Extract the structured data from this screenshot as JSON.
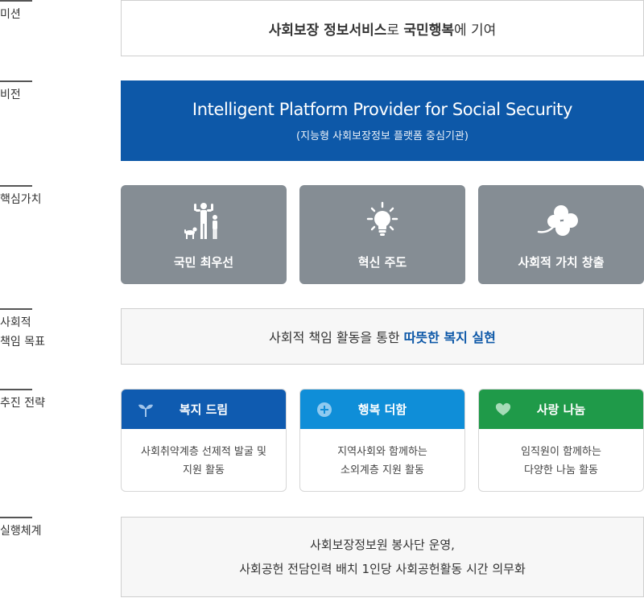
{
  "sections": {
    "mission": "미션",
    "vision": "비전",
    "core_values": "핵심가치",
    "csr_goal": "사회적\n책임 목표",
    "strategy": "추진 전략",
    "execution": "실행체계"
  },
  "mission": {
    "part1": "사회보장 정보서비스",
    "part2": "로 ",
    "part3": "국민행복",
    "part4": "에 기여"
  },
  "vision": {
    "english": "Intelligent Platform Provider for Social Security",
    "korean": "(지능형 사회보장정보 플랫폼 중심기관)",
    "color": "#0d58a8"
  },
  "core_values": [
    {
      "label": "국민 최우선",
      "icon": "family-icon"
    },
    {
      "label": "혁신 주도",
      "icon": "lightbulb-icon"
    },
    {
      "label": "사회적 가치 창출",
      "icon": "clover-icon"
    }
  ],
  "csr_goal": {
    "normal": "사회적 책임 활동을 통한 ",
    "highlight": "따뜻한 복지 실현"
  },
  "strategies": [
    {
      "title": "복지 드림",
      "desc": "사회취약계층 선제적 발굴 및\n지원 활동",
      "color": "#0f5bb0",
      "icon": "sprout-icon"
    },
    {
      "title": "행복 더함",
      "desc": "지역사회와 함께하는\n소외계층 지원 활동",
      "color": "#0f8ed8",
      "icon": "plus-circle-icon"
    },
    {
      "title": "사랑 나눔",
      "desc": "임직원이 함께하는\n다양한 나눔 활동",
      "color": "#1f9a49",
      "icon": "heart-icon"
    }
  ],
  "execution": "사회보장정보원 봉사단 운영,\n사회공헌 전담인력 배치 1인당 사회공헌활동 시간 의무화"
}
